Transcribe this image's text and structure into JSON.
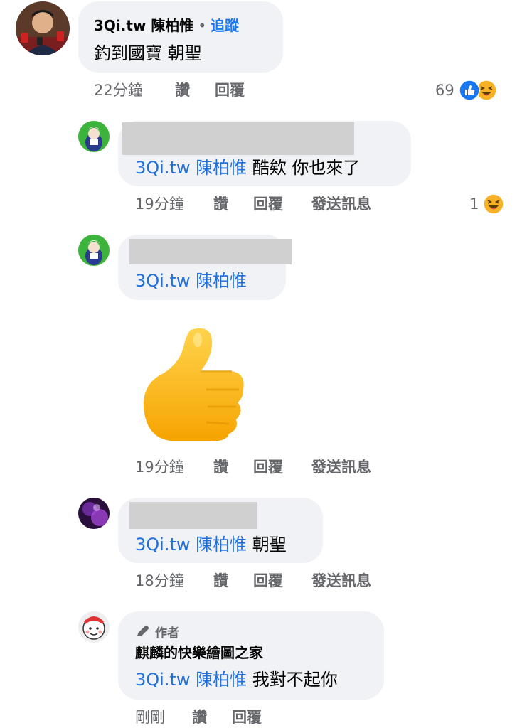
{
  "comments": [
    {
      "author": "3Qi.tw 陳柏惟",
      "follow_label": "追蹤",
      "text": "釣到國寶 朝聖",
      "time": "22分鐘",
      "like": "讚",
      "reply": "回覆",
      "reaction_count": "69"
    },
    {
      "mention": "3Qi.tw 陳柏惟",
      "text": "酷欸 你也來了",
      "time": "19分鐘",
      "like": "讚",
      "reply": "回覆",
      "message": "發送訊息",
      "reaction_count": "1"
    },
    {
      "mention": "3Qi.tw 陳柏惟",
      "sticker": "thumbs-up",
      "time": "19分鐘",
      "like": "讚",
      "reply": "回覆",
      "message": "發送訊息"
    },
    {
      "mention": "3Qi.tw 陳柏惟",
      "text": "朝聖",
      "time": "18分鐘",
      "like": "讚",
      "reply": "回覆",
      "message": "發送訊息"
    },
    {
      "badge": "作者",
      "author": "麒麟的快樂繪圖之家",
      "mention": "3Qi.tw 陳柏惟",
      "text": "我對不起你",
      "time": "剛剛",
      "like": "讚",
      "reply": "回覆"
    }
  ],
  "colors": {
    "bubble": "#f0f2f5",
    "mention": "#216fdb",
    "follow": "#1877f2",
    "meta": "#65676b",
    "like_blue": "#1877f2",
    "haha_yellow": "#f7b125"
  }
}
